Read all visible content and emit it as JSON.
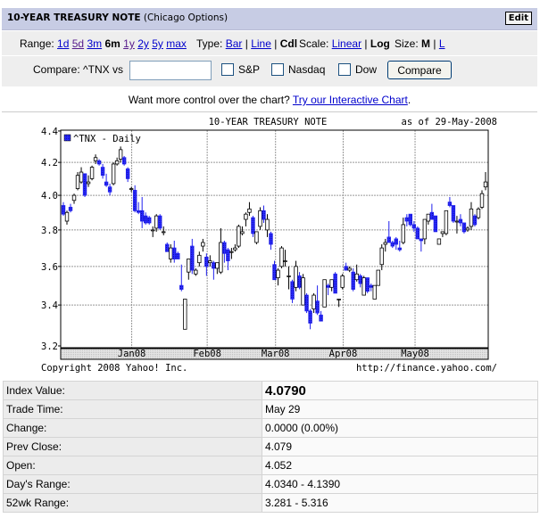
{
  "header": {
    "title": "10-YEAR TREASURY NOTE",
    "subtitle": "(Chicago Options)",
    "edit_label": "Edit"
  },
  "controls": {
    "range_label": "Range:",
    "ranges": [
      "1d",
      "5d",
      "3m",
      "6m",
      "1y",
      "2y",
      "5y",
      "max"
    ],
    "range_selected": "6m",
    "type_label": "Type:",
    "types": [
      "Bar",
      "Line",
      "Cdl"
    ],
    "type_selected": "Cdl",
    "scale_label": "Scale:",
    "scales": [
      "Linear",
      "Log"
    ],
    "scale_selected": "Log",
    "size_label": "Size:",
    "sizes": [
      "M",
      "L"
    ],
    "size_selected": "M",
    "sep": "|"
  },
  "compare": {
    "label": "Compare: ^TNX vs",
    "input_value": "",
    "options": [
      "S&P",
      "Nasdaq",
      "Dow"
    ],
    "button": "Compare"
  },
  "more": {
    "text": "Want more control over the chart?",
    "link": "Try our Interactive Chart",
    "end": "."
  },
  "chart_data": {
    "type": "candlestick",
    "title": "10-YEAR TREASURY NOTE",
    "as_of": "as of 29-May-2008",
    "legend": "^TNX - Daily",
    "legend_placement": "top-left",
    "copyright": "Copyright 2008 Yahoo! Inc.",
    "source": "http://finance.yahoo.com/",
    "yscale": "log",
    "ylim": [
      3.2,
      4.4
    ],
    "yticks": [
      "4.4",
      "4.2",
      "4.0",
      "3.8",
      "3.6",
      "3.4",
      "3.2"
    ],
    "xticks": [
      {
        "label": "Jan08",
        "index": 19.1
      },
      {
        "label": "Feb08",
        "index": 40.2
      },
      {
        "label": "Mar08",
        "index": 59.3
      },
      {
        "label": "Apr08",
        "index": 78.2
      },
      {
        "label": "May08",
        "index": 98.3
      }
    ],
    "grid": true,
    "colors": {
      "down": "#2020ee",
      "up": "#ffffff",
      "outline": "#000000"
    },
    "ohlc": [
      [
        3.94,
        3.96,
        3.88,
        3.89
      ],
      [
        3.85,
        3.91,
        3.83,
        3.9
      ],
      [
        3.93,
        3.95,
        3.9,
        3.91
      ],
      [
        3.97,
        4.01,
        3.95,
        4.0
      ],
      [
        4.04,
        4.14,
        4.03,
        4.12
      ],
      [
        4.08,
        4.17,
        4.07,
        4.14
      ],
      [
        4.13,
        4.13,
        3.99,
        4.0
      ],
      [
        4.07,
        4.12,
        4.05,
        4.08
      ],
      [
        4.1,
        4.18,
        4.09,
        4.17
      ],
      [
        4.21,
        4.25,
        4.19,
        4.23
      ],
      [
        4.21,
        4.22,
        4.18,
        4.19
      ],
      [
        4.17,
        4.19,
        4.1,
        4.12
      ],
      [
        4.08,
        4.13,
        4.05,
        4.06
      ],
      [
        4.05,
        4.07,
        4.0,
        4.02
      ],
      [
        4.07,
        4.2,
        4.06,
        4.19
      ],
      [
        4.19,
        4.23,
        4.18,
        4.21
      ],
      [
        4.22,
        4.3,
        4.2,
        4.28
      ],
      [
        4.23,
        4.24,
        4.18,
        4.19
      ],
      [
        4.16,
        4.17,
        4.08,
        4.1
      ],
      [
        4.04,
        4.05,
        4.02,
        4.04
      ],
      [
        4.03,
        4.06,
        3.9,
        3.91
      ],
      [
        3.91,
        3.96,
        3.89,
        3.9
      ],
      [
        3.91,
        3.99,
        3.81,
        3.85
      ],
      [
        3.88,
        3.9,
        3.83,
        3.84
      ],
      [
        3.87,
        3.88,
        3.83,
        3.84
      ],
      [
        3.8,
        3.82,
        3.76,
        3.8
      ],
      [
        3.81,
        3.89,
        3.79,
        3.88
      ],
      [
        3.88,
        3.89,
        3.8,
        3.81
      ],
      [
        3.79,
        3.82,
        3.77,
        3.79
      ],
      [
        3.72,
        3.73,
        3.68,
        3.68
      ],
      [
        3.64,
        3.72,
        3.62,
        3.7
      ],
      [
        3.7,
        3.74,
        3.62,
        3.64
      ],
      [
        3.67,
        3.68,
        3.64,
        3.64
      ],
      [
        3.5,
        3.61,
        3.47,
        3.48
      ],
      [
        3.28,
        3.43,
        3.28,
        3.43
      ],
      [
        3.57,
        3.64,
        3.53,
        3.64
      ],
      [
        3.71,
        3.75,
        3.56,
        3.58
      ],
      [
        3.56,
        3.59,
        3.55,
        3.58
      ],
      [
        3.62,
        3.68,
        3.6,
        3.66
      ],
      [
        3.71,
        3.75,
        3.68,
        3.73
      ],
      [
        3.65,
        3.67,
        3.55,
        3.6
      ],
      [
        3.62,
        3.66,
        3.6,
        3.63
      ],
      [
        3.62,
        3.63,
        3.53,
        3.59
      ],
      [
        3.59,
        3.62,
        3.56,
        3.62
      ],
      [
        3.57,
        3.81,
        3.56,
        3.73
      ],
      [
        3.73,
        3.74,
        3.62,
        3.67
      ],
      [
        3.69,
        3.7,
        3.58,
        3.63
      ],
      [
        3.68,
        3.7,
        3.64,
        3.68
      ],
      [
        3.69,
        3.72,
        3.68,
        3.7
      ],
      [
        3.71,
        3.83,
        3.7,
        3.82
      ],
      [
        3.78,
        3.82,
        3.77,
        3.79
      ],
      [
        3.86,
        3.9,
        3.82,
        3.89
      ],
      [
        3.9,
        3.96,
        3.88,
        3.92
      ],
      [
        3.87,
        3.88,
        3.76,
        3.78
      ],
      [
        3.73,
        3.79,
        3.72,
        3.79
      ],
      [
        3.82,
        3.93,
        3.8,
        3.91
      ],
      [
        3.91,
        3.94,
        3.84,
        3.86
      ],
      [
        3.8,
        3.89,
        3.76,
        3.86
      ],
      [
        3.78,
        3.79,
        3.69,
        3.72
      ],
      [
        3.61,
        3.63,
        3.53,
        3.53
      ],
      [
        3.54,
        3.59,
        3.5,
        3.58
      ],
      [
        3.6,
        3.71,
        3.59,
        3.7
      ],
      [
        3.63,
        3.69,
        3.6,
        3.63
      ],
      [
        3.55,
        3.6,
        3.48,
        3.55
      ],
      [
        3.52,
        3.53,
        3.41,
        3.43
      ],
      [
        3.49,
        3.63,
        3.47,
        3.6
      ],
      [
        3.55,
        3.57,
        3.48,
        3.49
      ],
      [
        3.4,
        3.56,
        3.4,
        3.54
      ],
      [
        3.45,
        3.46,
        3.36,
        3.37
      ],
      [
        3.37,
        3.38,
        3.28,
        3.31
      ],
      [
        3.38,
        3.46,
        3.36,
        3.45
      ],
      [
        3.42,
        3.5,
        3.35,
        3.36
      ],
      [
        3.35,
        3.37,
        3.32,
        3.32
      ],
      [
        3.39,
        3.53,
        3.39,
        3.53
      ],
      [
        3.5,
        3.51,
        3.45,
        3.49
      ],
      [
        3.49,
        3.53,
        3.47,
        3.53
      ],
      [
        3.56,
        3.57,
        3.46,
        3.46
      ],
      [
        3.43,
        3.43,
        3.39,
        3.43
      ],
      [
        3.49,
        3.56,
        3.48,
        3.55
      ],
      [
        3.6,
        3.62,
        3.58,
        3.58
      ],
      [
        3.58,
        3.6,
        3.57,
        3.59
      ],
      [
        3.57,
        3.59,
        3.47,
        3.48
      ],
      [
        3.53,
        3.61,
        3.52,
        3.56
      ],
      [
        3.55,
        3.56,
        3.49,
        3.51
      ],
      [
        3.45,
        3.55,
        3.45,
        3.54
      ],
      [
        3.54,
        3.54,
        3.46,
        3.47
      ],
      [
        3.5,
        3.51,
        3.47,
        3.49
      ],
      [
        3.43,
        3.5,
        3.43,
        3.5
      ],
      [
        3.5,
        3.58,
        3.5,
        3.58
      ],
      [
        3.61,
        3.72,
        3.58,
        3.7
      ],
      [
        3.72,
        3.75,
        3.68,
        3.73
      ],
      [
        3.76,
        3.85,
        3.73,
        3.73
      ],
      [
        3.73,
        3.74,
        3.7,
        3.71
      ],
      [
        3.75,
        3.76,
        3.69,
        3.72
      ],
      [
        3.7,
        3.74,
        3.68,
        3.69
      ],
      [
        3.73,
        3.87,
        3.72,
        3.83
      ],
      [
        3.87,
        3.89,
        3.82,
        3.85
      ],
      [
        3.89,
        3.89,
        3.82,
        3.83
      ],
      [
        3.83,
        3.85,
        3.79,
        3.81
      ],
      [
        3.81,
        3.82,
        3.75,
        3.75
      ],
      [
        3.75,
        3.75,
        3.68,
        3.74
      ],
      [
        3.75,
        3.86,
        3.72,
        3.86
      ],
      [
        3.85,
        3.89,
        3.83,
        3.89
      ],
      [
        3.9,
        3.95,
        3.86,
        3.86
      ],
      [
        3.88,
        3.88,
        3.79,
        3.79
      ],
      [
        3.72,
        3.75,
        3.72,
        3.75
      ],
      [
        3.78,
        3.79,
        3.76,
        3.79
      ],
      [
        3.78,
        3.91,
        3.77,
        3.91
      ],
      [
        3.96,
        3.99,
        3.93,
        3.94
      ],
      [
        3.94,
        3.94,
        3.84,
        3.85
      ],
      [
        3.85,
        3.88,
        3.78,
        3.85
      ],
      [
        3.86,
        3.89,
        3.82,
        3.84
      ],
      [
        3.84,
        3.84,
        3.78,
        3.79
      ],
      [
        3.8,
        3.82,
        3.79,
        3.81
      ],
      [
        3.82,
        3.96,
        3.8,
        3.92
      ],
      [
        3.88,
        3.89,
        3.82,
        3.83
      ],
      [
        3.87,
        3.93,
        3.86,
        3.92
      ],
      [
        3.93,
        4.03,
        3.92,
        4.01
      ],
      [
        4.05,
        4.14,
        4.03,
        4.08
      ]
    ]
  },
  "quote": [
    {
      "label": "Index Value:",
      "value": "4.0790"
    },
    {
      "label": "Trade Time:",
      "value": "May 29"
    },
    {
      "label": "Change:",
      "value": "0.0000 (0.00%)"
    },
    {
      "label": "Prev Close:",
      "value": "4.079"
    },
    {
      "label": "Open:",
      "value": "4.052"
    },
    {
      "label": "Day's Range:",
      "value": "4.0340 - 4.1390"
    },
    {
      "label": "52wk Range:",
      "value": "3.281 - 5.316"
    }
  ]
}
